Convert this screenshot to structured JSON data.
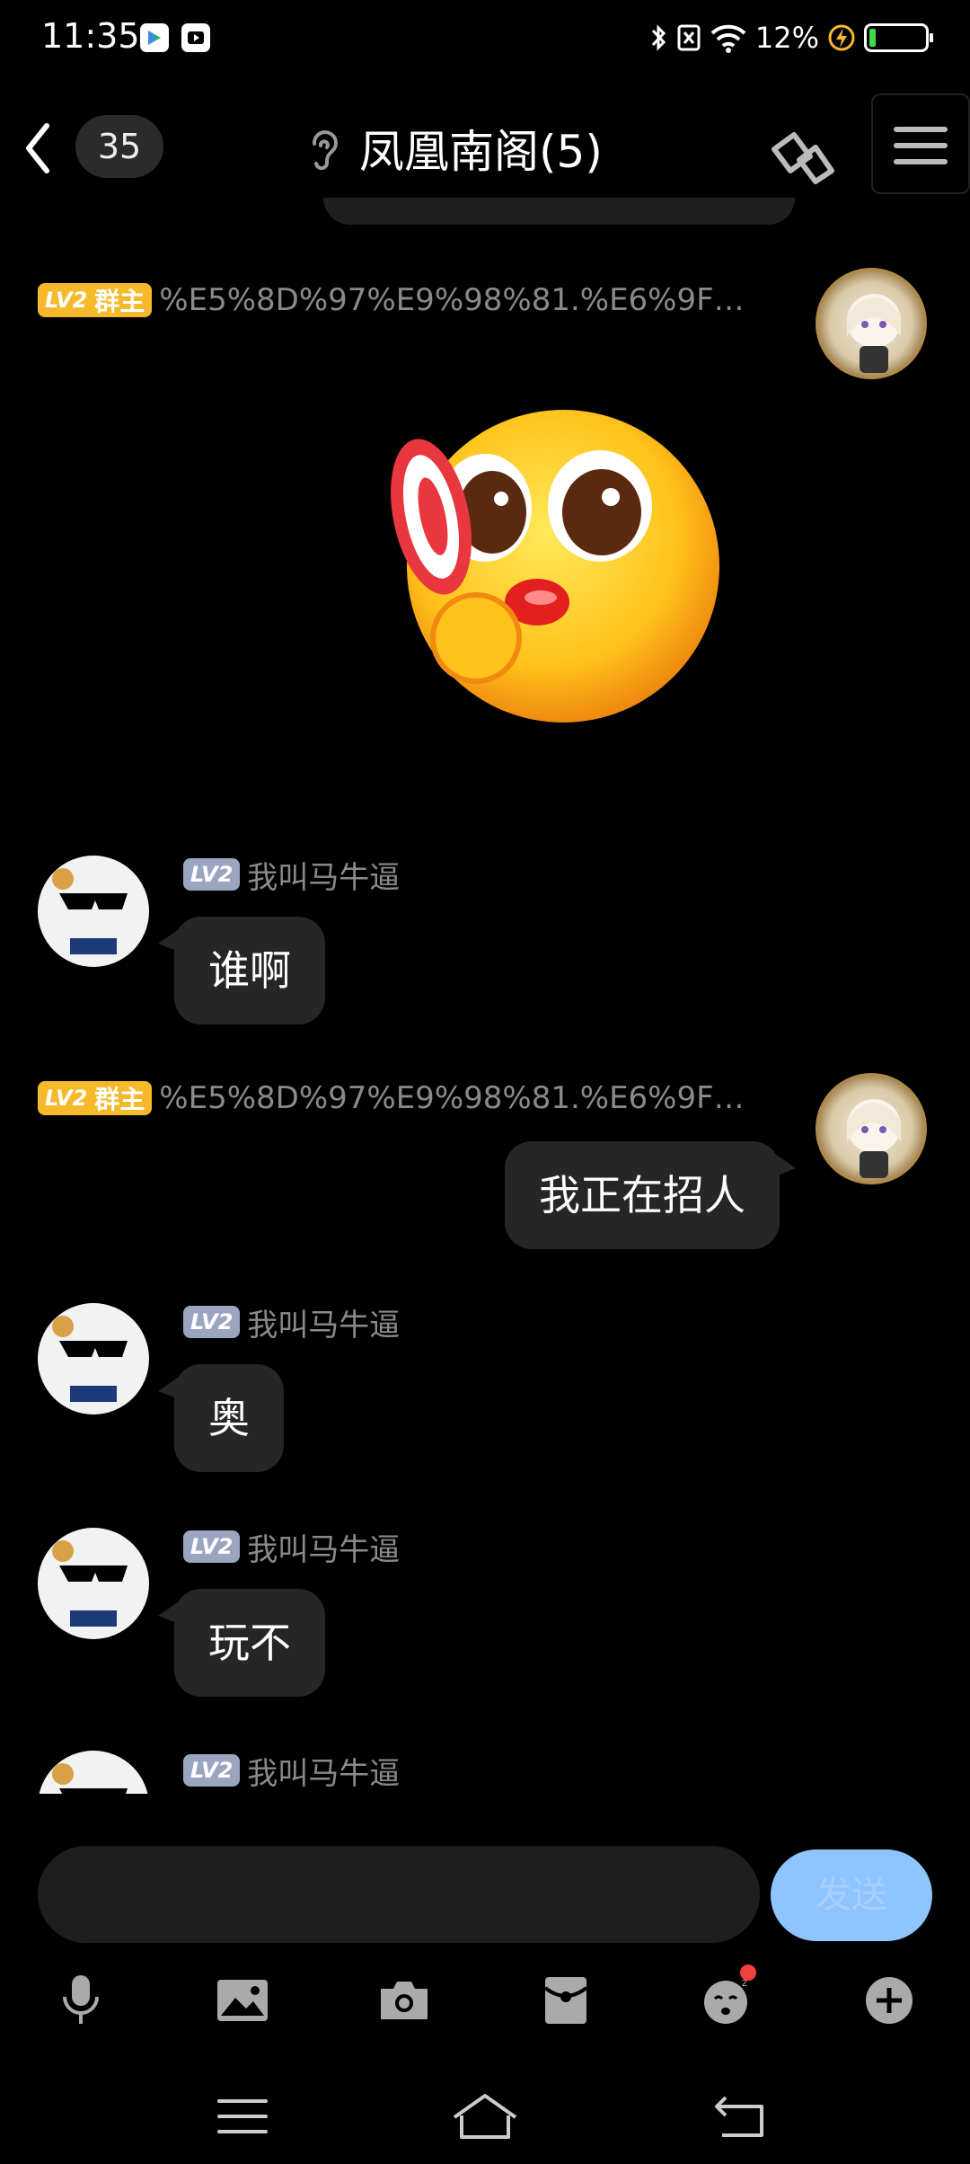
{
  "status_bar": {
    "time": "11:35",
    "battery_percent": "12%",
    "battery_level": 0.12
  },
  "header": {
    "unread_count": "35",
    "title": "凤凰南阁(5)"
  },
  "messages": [
    {
      "side": "right",
      "badge_level": "LV2",
      "badge_role": "群主",
      "sender": "%E5%8D%97%E9%98%81.%E6%9F…",
      "type": "sticker",
      "sticker": "lollipop-emoji"
    },
    {
      "side": "left",
      "badge_level": "LV2",
      "sender": "我叫马牛逼",
      "text": "谁啊"
    },
    {
      "side": "right",
      "badge_level": "LV2",
      "badge_role": "群主",
      "sender": "%E5%8D%97%E9%98%81.%E6%9F…",
      "text": "我正在招人"
    },
    {
      "side": "left",
      "badge_level": "LV2",
      "sender": "我叫马牛逼",
      "text": "奥"
    },
    {
      "side": "left",
      "badge_level": "LV2",
      "sender": "我叫马牛逼",
      "text": "玩不"
    },
    {
      "side": "left",
      "badge_level": "LV2",
      "sender": "我叫马牛逼"
    }
  ],
  "input": {
    "value": "",
    "send_label": "发送"
  },
  "toolbar": [
    "mic-icon",
    "image-icon",
    "camera-icon",
    "red-packet-icon",
    "sticker-icon",
    "plus-icon"
  ],
  "colors": {
    "owner_badge": "#f6b92a",
    "level_badge": "#9aa6c0",
    "send_button": "#8ec4ff",
    "bubble": "#262626"
  }
}
